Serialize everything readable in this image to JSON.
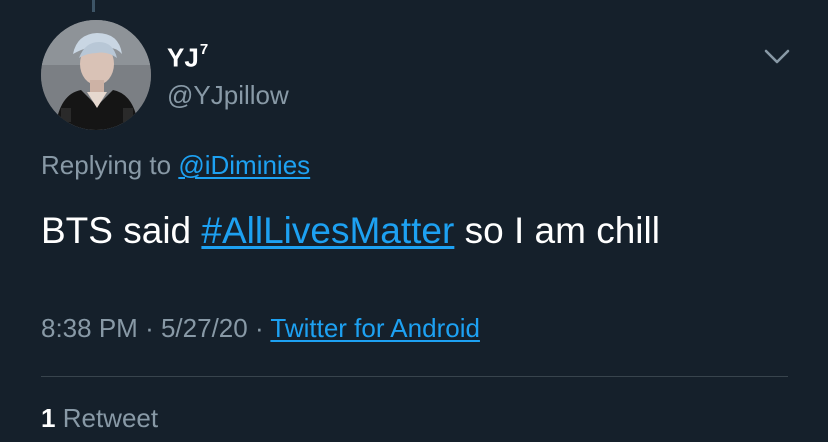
{
  "colors": {
    "background": "#15202b",
    "primary_text": "#ffffff",
    "secondary_text": "#8899a6",
    "link": "#1da1f2",
    "divider": "#38444d"
  },
  "author": {
    "display_name": "YJ",
    "display_name_sup": "7",
    "handle": "@YJpillow",
    "avatar_icon": "user-avatar"
  },
  "menu": {
    "icon": "chevron-down-icon"
  },
  "reply": {
    "prefix": "Replying to",
    "user": "@iDiminies"
  },
  "tweet": {
    "text_before": "BTS said",
    "hashtag": "#AllLivesMatter",
    "text_after": "so I am chill"
  },
  "meta": {
    "time": "8:38 PM",
    "date": "5/27/20",
    "separator": "·",
    "source": "Twitter for Android"
  },
  "stats": {
    "retweet_count": "1",
    "retweet_label": "Retweet"
  }
}
